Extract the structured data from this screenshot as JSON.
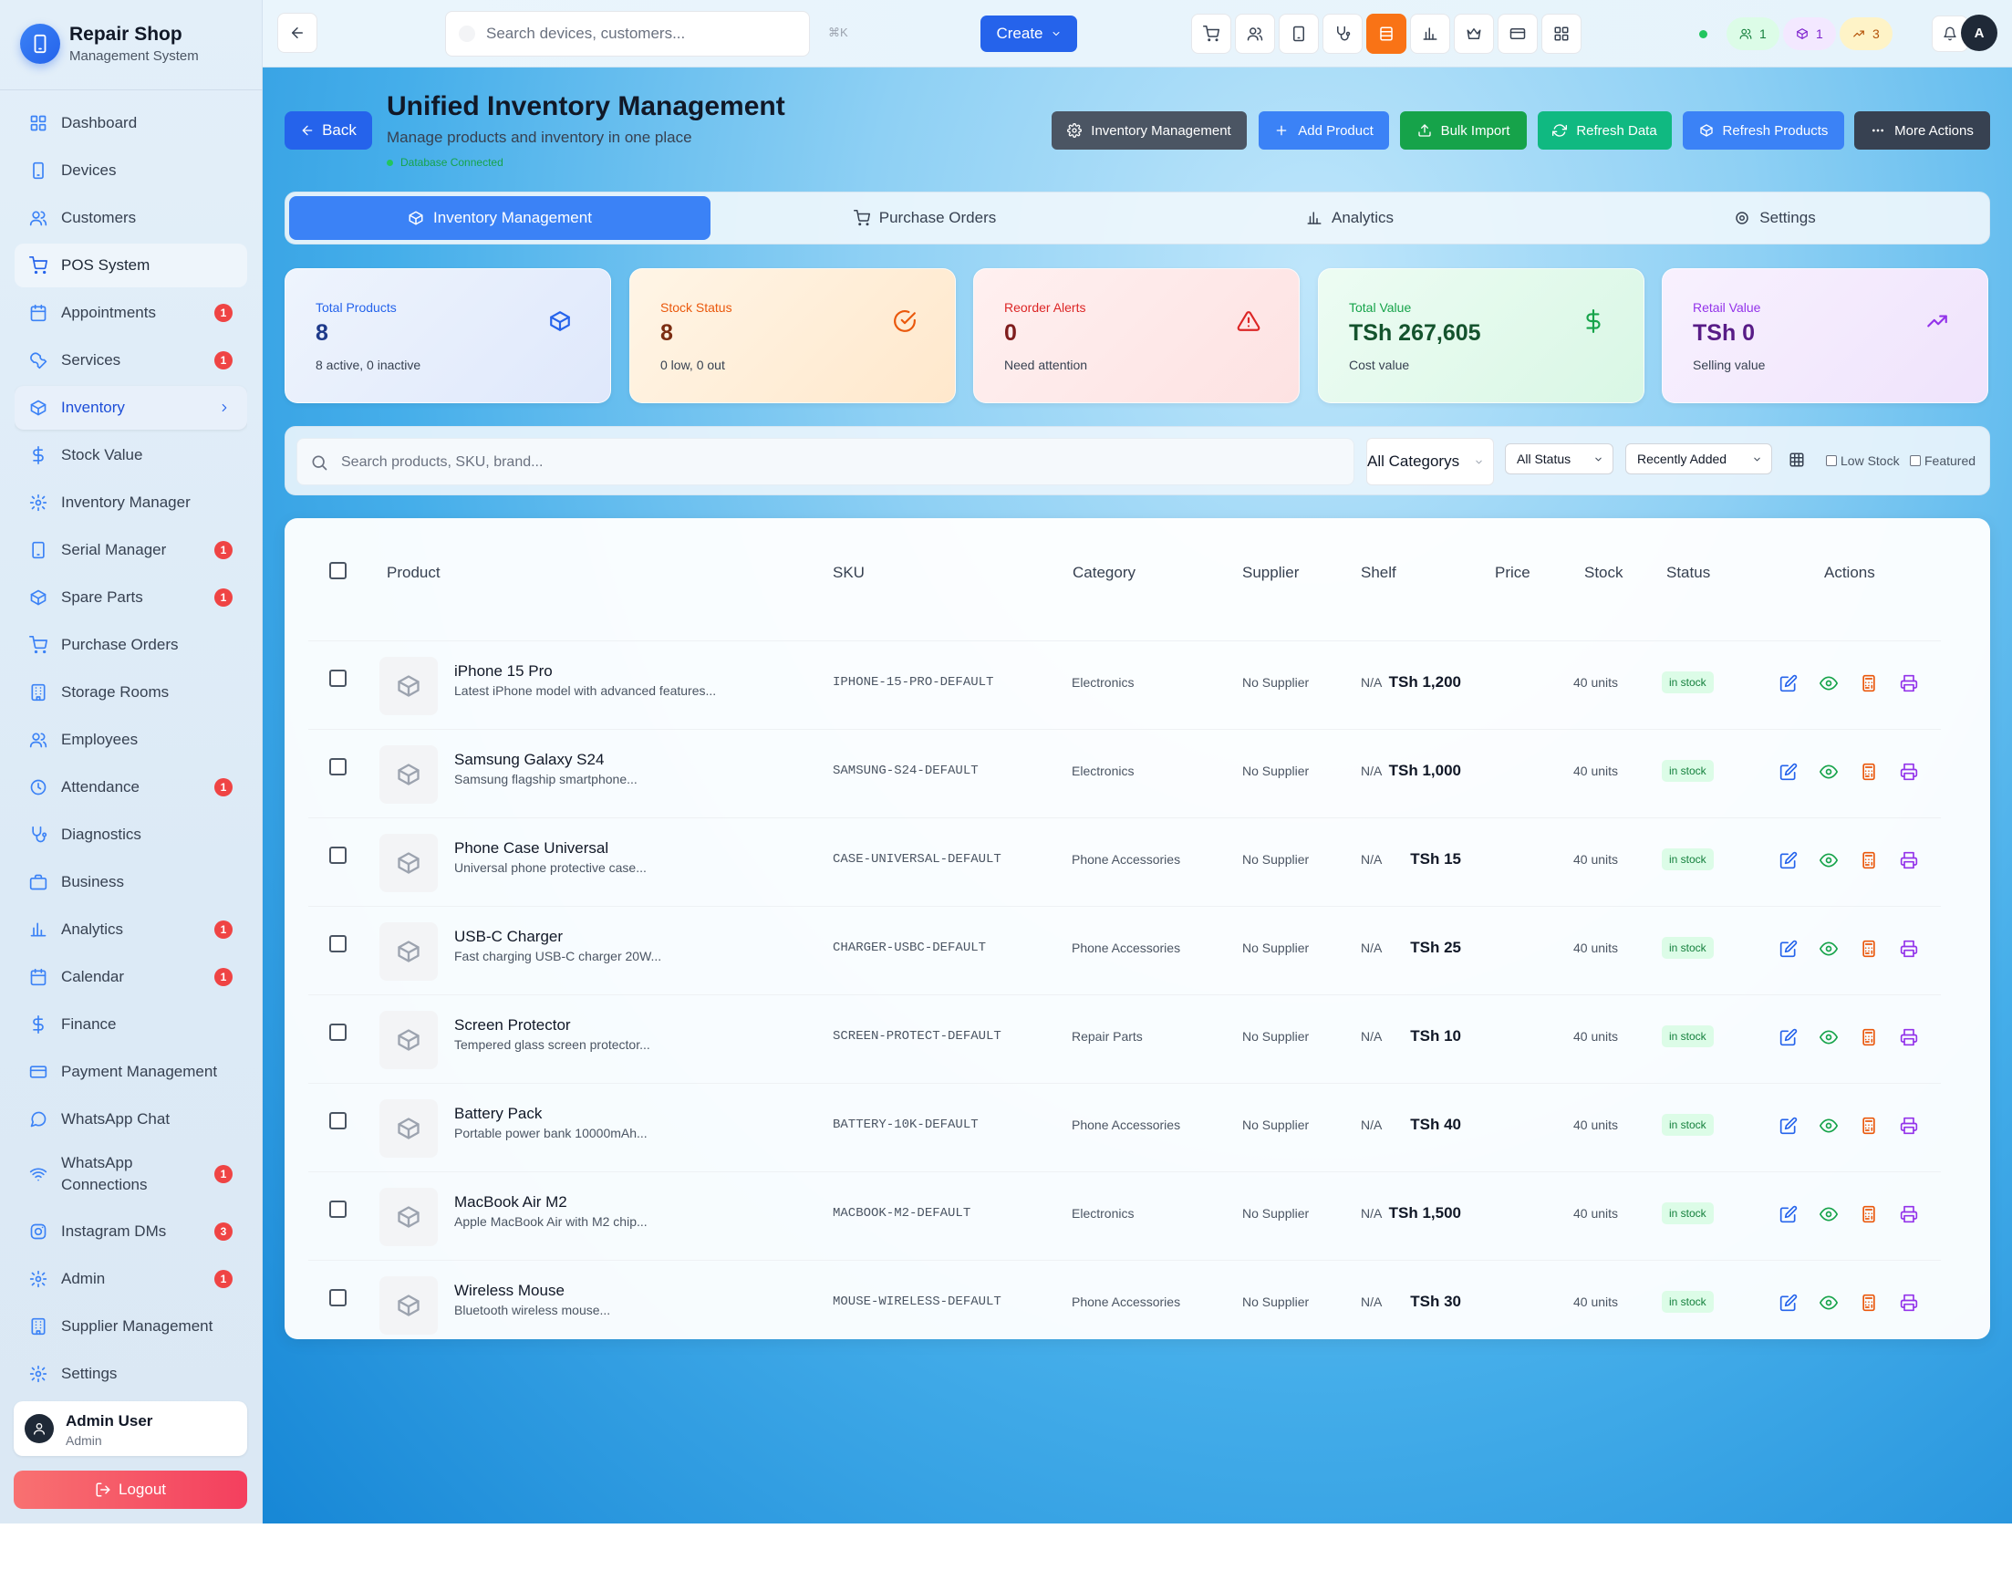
{
  "sidebar": {
    "brand_title": "Repair Shop",
    "brand_subtitle": "Management System",
    "items": [
      {
        "label": "Dashboard",
        "icon": "dashboard-icon"
      },
      {
        "label": "Devices",
        "icon": "device-icon"
      },
      {
        "label": "Customers",
        "icon": "users-icon"
      },
      {
        "label": "POS System",
        "icon": "cart-icon"
      },
      {
        "label": "Appointments",
        "icon": "calendar-icon",
        "badge": "1"
      },
      {
        "label": "Services",
        "icon": "wrench-icon",
        "badge": "1"
      },
      {
        "label": "Inventory",
        "icon": "box-icon"
      },
      {
        "label": "Stock Value",
        "icon": "dollar-icon"
      },
      {
        "label": "Inventory Manager",
        "icon": "gear-icon"
      },
      {
        "label": "Serial Manager",
        "icon": "tablet-icon",
        "badge": "1"
      },
      {
        "label": "Spare Parts",
        "icon": "box-icon",
        "badge": "1"
      },
      {
        "label": "Purchase Orders",
        "icon": "cart-icon"
      },
      {
        "label": "Storage Rooms",
        "icon": "building-icon"
      },
      {
        "label": "Employees",
        "icon": "users-icon"
      },
      {
        "label": "Attendance",
        "icon": "clock-icon",
        "badge": "1"
      },
      {
        "label": "Diagnostics",
        "icon": "stethoscope-icon"
      },
      {
        "label": "Business",
        "icon": "briefcase-icon"
      },
      {
        "label": "Analytics",
        "icon": "bar-chart-icon",
        "badge": "1"
      },
      {
        "label": "Calendar",
        "icon": "calendar-icon",
        "badge": "1"
      },
      {
        "label": "Finance",
        "icon": "dollar-icon"
      },
      {
        "label": "Payment Management",
        "icon": "credit-card-icon"
      },
      {
        "label": "WhatsApp Chat",
        "icon": "chat-icon"
      },
      {
        "label": "WhatsApp Connections",
        "icon": "wifi-icon",
        "badge": "1"
      },
      {
        "label": "Instagram DMs",
        "icon": "instagram-icon",
        "badge": "3"
      },
      {
        "label": "Admin",
        "icon": "gear-icon",
        "badge": "1"
      },
      {
        "label": "Supplier Management",
        "icon": "building-icon"
      },
      {
        "label": "Settings",
        "icon": "gear-icon"
      }
    ],
    "user_name": "Admin User",
    "user_role": "Admin",
    "logout_label": "Logout"
  },
  "topbar": {
    "search_placeholder": "Search devices, customers...",
    "shortcut": "⌘K",
    "create_label": "Create",
    "icons": [
      "cart-icon",
      "users-icon",
      "tablet-icon",
      "stethoscope-icon",
      "inventory-icon",
      "bar-chart-icon",
      "crown-icon",
      "credit-card-icon",
      "grid-icon"
    ],
    "active_icon": "inventory-icon",
    "pill_users": "1",
    "pill_products": "1",
    "pill_trending": "3",
    "avatar_initial": "A"
  },
  "header": {
    "back_label": "Back",
    "title": "Unified Inventory Management",
    "subtitle": "Manage products and inventory in one place",
    "db_status": "Database Connected",
    "buttons": {
      "inventory_management": "Inventory Management",
      "add_product": "Add Product",
      "bulk_import": "Bulk Import",
      "refresh_data": "Refresh Data",
      "refresh_products": "Refresh Products",
      "more_actions": "More Actions"
    }
  },
  "tabs": [
    {
      "label": "Inventory Management",
      "active": true
    },
    {
      "label": "Purchase Orders",
      "active": false
    },
    {
      "label": "Analytics",
      "active": false
    },
    {
      "label": "Settings",
      "active": false
    }
  ],
  "stats": [
    {
      "label": "Total Products",
      "value": "8",
      "sub": "8 active, 0 inactive"
    },
    {
      "label": "Stock Status",
      "value": "8",
      "sub": "0 low, 0 out"
    },
    {
      "label": "Reorder Alerts",
      "value": "0",
      "sub": "Need attention"
    },
    {
      "label": "Total Value",
      "value": "TSh 267,605",
      "sub": "Cost value"
    },
    {
      "label": "Retail Value",
      "value": "TSh 0",
      "sub": "Selling value"
    }
  ],
  "filters": {
    "search_placeholder": "Search products, SKU, brand...",
    "category": "All Categorys",
    "status": "All Status",
    "sort": "Recently Added",
    "low_stock_label": "Low Stock",
    "featured_label": "Featured"
  },
  "table": {
    "columns": {
      "product": "Product",
      "sku": "SKU",
      "category": "Category",
      "supplier": "Supplier",
      "shelf": "Shelf",
      "price": "Price",
      "stock": "Stock",
      "status": "Status",
      "actions": "Actions"
    },
    "rows": [
      {
        "name": "iPhone 15 Pro",
        "desc": "Latest iPhone model with advanced features...",
        "sku": "IPHONE-15-PRO-DEFAULT",
        "category": "Electronics",
        "supplier": "No Supplier",
        "shelf": "N/A",
        "price": "TSh 1,200",
        "stock": "40 units",
        "status": "in stock"
      },
      {
        "name": "Samsung Galaxy S24",
        "desc": "Samsung flagship smartphone...",
        "sku": "SAMSUNG-S24-DEFAULT",
        "category": "Electronics",
        "supplier": "No Supplier",
        "shelf": "N/A",
        "price": "TSh 1,000",
        "stock": "40 units",
        "status": "in stock"
      },
      {
        "name": "Phone Case Universal",
        "desc": "Universal phone protective case...",
        "sku": "CASE-UNIVERSAL-DEFAULT",
        "category": "Phone Accessories",
        "supplier": "No Supplier",
        "shelf": "N/A",
        "price": "TSh 15",
        "stock": "40 units",
        "status": "in stock"
      },
      {
        "name": "USB-C Charger",
        "desc": "Fast charging USB-C charger 20W...",
        "sku": "CHARGER-USBC-DEFAULT",
        "category": "Phone Accessories",
        "supplier": "No Supplier",
        "shelf": "N/A",
        "price": "TSh 25",
        "stock": "40 units",
        "status": "in stock"
      },
      {
        "name": "Screen Protector",
        "desc": "Tempered glass screen protector...",
        "sku": "SCREEN-PROTECT-DEFAULT",
        "category": "Repair Parts",
        "supplier": "No Supplier",
        "shelf": "N/A",
        "price": "TSh 10",
        "stock": "40 units",
        "status": "in stock"
      },
      {
        "name": "Battery Pack",
        "desc": "Portable power bank 10000mAh...",
        "sku": "BATTERY-10K-DEFAULT",
        "category": "Phone Accessories",
        "supplier": "No Supplier",
        "shelf": "N/A",
        "price": "TSh 40",
        "stock": "40 units",
        "status": "in stock"
      },
      {
        "name": "MacBook Air M2",
        "desc": "Apple MacBook Air with M2 chip...",
        "sku": "MACBOOK-M2-DEFAULT",
        "category": "Electronics",
        "supplier": "No Supplier",
        "shelf": "N/A",
        "price": "TSh 1,500",
        "stock": "40 units",
        "status": "in stock"
      },
      {
        "name": "Wireless Mouse",
        "desc": "Bluetooth wireless mouse...",
        "sku": "MOUSE-WIRELESS-DEFAULT",
        "category": "Phone Accessories",
        "supplier": "No Supplier",
        "shelf": "N/A",
        "price": "TSh 30",
        "stock": "40 units",
        "status": "in stock"
      }
    ]
  }
}
